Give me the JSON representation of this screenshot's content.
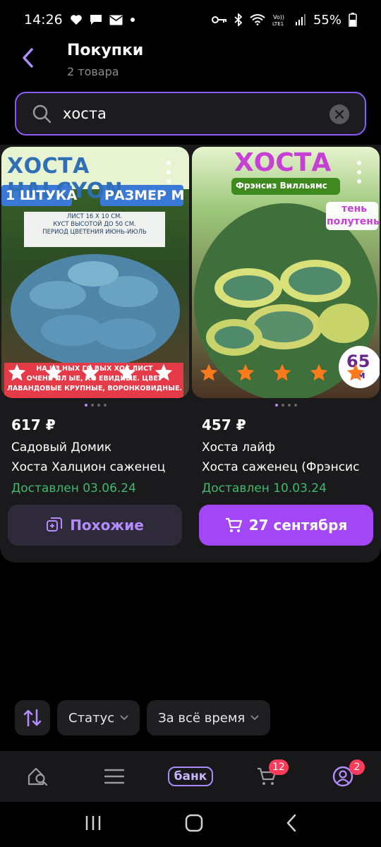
{
  "status_bar": {
    "time": "14:26",
    "battery": "55%",
    "left_icons": [
      "heart-icon",
      "message-icon",
      "mail-icon",
      "dot-icon"
    ],
    "right_icons": [
      "key-icon",
      "bluetooth-icon",
      "wifi-icon",
      "volte-icon",
      "signal-icon",
      "battery-icon"
    ]
  },
  "header": {
    "title": "Покупки",
    "subtitle": "2 товара"
  },
  "search": {
    "value": "хоста"
  },
  "products": [
    {
      "price": "617 ₽",
      "seller": "Садовый Домик",
      "name": "Хоста Халцион саженец",
      "status": "Доставлен 03.06.24",
      "image": {
        "title": "ХОСТА HALCYON",
        "badge_left": "1 ШТУКА",
        "badge_right": "РАЗМЕР М",
        "info": [
          "ЛИСТ 16 Х 10 СМ.",
          "КУСТ ВЫСОТОЙ ДО 50 СМ.",
          "ПЕРИОД ЦВЕТЕНИЯ ИЮНЬ-ИЮЛЬ"
        ],
        "footer": [
          "НА ИЗ НЫХ ГО ВЫХ ХОС ЛИСТ",
          "ОЧЕНЬ ПЛ ЫЕ, КО ЕВИДНЫЕ. ЦВЕТ",
          "ЛАВАНДОВЫЕ КРУПНЫЕ, ВОРОНКОВИДНЫЕ."
        ]
      },
      "rating": 5,
      "rating_color": "#ffffff"
    },
    {
      "price": "457 ₽",
      "seller": "Хоста лайф",
      "name": "Хоста саженец (Фрэнсис",
      "status": "Доставлен 10.03.24",
      "image": {
        "title": "ХОСТА",
        "subtitle": "Фрэнсиз Вилльямс",
        "tag_1": "тень",
        "tag_2": "полутень",
        "size": "65",
        "size_unit": "см"
      },
      "rating": 5,
      "rating_color": "#ff7a1a"
    }
  ],
  "buttons": {
    "similar": "Похожие",
    "date": "27 сентября"
  },
  "filters": {
    "status": "Статус",
    "period": "За всё время"
  },
  "bottom_nav": {
    "bank_label": "банк",
    "cart_badge": "12",
    "profile_badge": "2"
  },
  "colors": {
    "accent": "#a346f5",
    "delivered": "#3dbb6b",
    "badge": "#ff3b5c"
  }
}
